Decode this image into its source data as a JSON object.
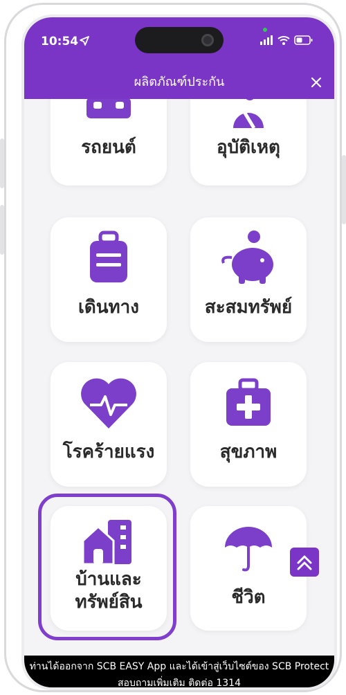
{
  "status_bar": {
    "time": "10:54"
  },
  "header": {
    "title": "ผลิตภัณฑ์ประกัน"
  },
  "products": [
    {
      "label": "รถยนต์",
      "icon": "car-icon"
    },
    {
      "label": "อุบัติเหตุ",
      "icon": "accident-icon"
    },
    {
      "label": "เดินทาง",
      "icon": "luggage-icon"
    },
    {
      "label": "สะสมทรัพย์",
      "icon": "piggy-bank-icon"
    },
    {
      "label": "โรคร้ายแรง",
      "icon": "heart-pulse-icon"
    },
    {
      "label": "สุขภาพ",
      "icon": "first-aid-kit-icon"
    },
    {
      "label_line1": "บ้านและ",
      "label_line2": "ทรัพย์สิน",
      "icon": "home-property-icon",
      "selected": true
    },
    {
      "label": "ชีวิต",
      "icon": "umbrella-icon"
    }
  ],
  "notice": {
    "line1": "ท่านได้ออกจาก SCB EASY App และได้เข้าสู่เว็บไซต์ของ SCB Protect",
    "line2": "สอบถามเพิ่มเติม ติดต่อ 1314"
  },
  "colors": {
    "brand": "#7a35c6",
    "icon": "#7b3fc9",
    "background": "#f4f4f6"
  }
}
